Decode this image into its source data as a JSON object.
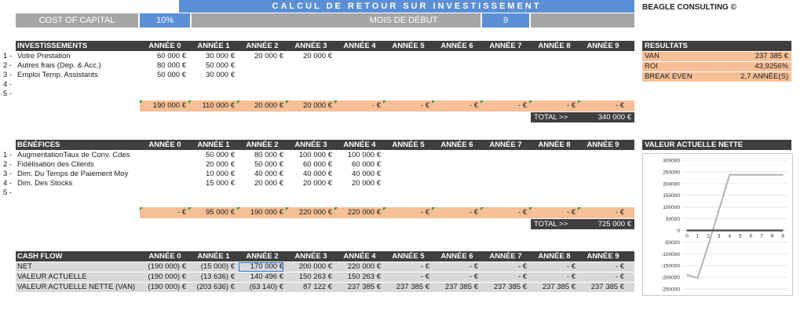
{
  "title": "CALCUL DE RETOUR SUR INVESTISSEMENT",
  "brand": "BEAGLE CONSULTING ©",
  "cost_of_capital": {
    "label": "COST OF CAPITAL",
    "value": "10%"
  },
  "start_month": {
    "label": "MOIS DE DÉBUT",
    "value": "9"
  },
  "years": [
    "ANNÉE 0",
    "ANNÉE 1",
    "ANNÉE 2",
    "ANNÉE 3",
    "ANNÉE 4",
    "ANNÉE 5",
    "ANNÉE 6",
    "ANNÉE 7",
    "ANNÉE 8",
    "ANNÉE 9"
  ],
  "investments": {
    "title": "INVESTISSEMENTS",
    "rows": [
      {
        "idx": "1 -",
        "label": "Votre Prestation",
        "values": [
          "60 000  €",
          "30 000  €",
          "20 000  €",
          "20 000  €",
          "",
          "",
          "",
          "",
          "",
          ""
        ]
      },
      {
        "idx": "2 -",
        "label": "Autres frais (Dep. & Acc.)",
        "values": [
          "80 000  €",
          "50 000  €",
          "",
          "",
          "",
          "",
          "",
          "",
          "",
          ""
        ]
      },
      {
        "idx": "3 -",
        "label": "Emploi Temp. Assistants",
        "values": [
          "50 000  €",
          "30 000  €",
          "",
          "",
          "",
          "",
          "",
          "",
          "",
          ""
        ]
      },
      {
        "idx": "4 -",
        "label": "",
        "values": [
          "",
          "",
          "",
          "",
          "",
          "",
          "",
          "",
          "",
          ""
        ]
      },
      {
        "idx": "5 -",
        "label": "",
        "values": [
          "",
          "",
          "",
          "",
          "",
          "",
          "",
          "",
          "",
          ""
        ]
      }
    ],
    "totals": [
      "190 000  €",
      "110 000  €",
      "20 000  €",
      "20 000  €",
      "-  €",
      "-  €",
      "-  €",
      "-  €",
      "-  €",
      "-  €"
    ],
    "total_label": "TOTAL >>",
    "total_value": "340 000  €"
  },
  "results": {
    "title": "RESULTATS",
    "rows": [
      {
        "label": "VAN",
        "value": "237 385  €"
      },
      {
        "label": "ROI",
        "value": "43,9256%"
      },
      {
        "label": "BREAK EVEN",
        "value": "2,7  ANNÉE(S)"
      }
    ]
  },
  "benefits": {
    "title": "BÉNÉFICES",
    "rows": [
      {
        "idx": "1 -",
        "label": "AugmentationTaux de Conv. Cdes",
        "values": [
          "",
          "50 000  €",
          "80 000  €",
          "100 000  €",
          "100 000  €",
          "",
          "",
          "",
          "",
          ""
        ]
      },
      {
        "idx": "2 -",
        "label": "Fidélisation des Clients",
        "values": [
          "",
          "20 000  €",
          "50 000  €",
          "60 000  €",
          "60 000  €",
          "",
          "",
          "",
          "",
          ""
        ]
      },
      {
        "idx": "3 -",
        "label": "Dim. Du Temps de Paiement Moy",
        "values": [
          "",
          "10 000  €",
          "40 000  €",
          "40 000  €",
          "40 000  €",
          "",
          "",
          "",
          "",
          ""
        ]
      },
      {
        "idx": "4 -",
        "label": "Dim. Des Stocks",
        "values": [
          "",
          "15 000  €",
          "20 000  €",
          "20 000  €",
          "20 000  €",
          "",
          "",
          "",
          "",
          ""
        ]
      },
      {
        "idx": "5 -",
        "label": "",
        "values": [
          "",
          "",
          "",
          "",
          "",
          "",
          "",
          "",
          "",
          ""
        ]
      }
    ],
    "totals": [
      "-  €",
      "95 000  €",
      "190 000  €",
      "220 000  €",
      "220 000  €",
      "-  €",
      "-  €",
      "-  €",
      "-  €",
      "-  €"
    ],
    "total_label": "TOTAL >>",
    "total_value": "725 000  €"
  },
  "cashflow": {
    "title": "CASH FLOW",
    "rows": [
      {
        "label": "NET",
        "values": [
          "(190 000) €",
          "(15 000) €",
          "170 000  €",
          "200 000  €",
          "220 000  €",
          "-  €",
          "-  €",
          "-  €",
          "-  €",
          "-  €"
        ]
      },
      {
        "label": "VALEUR ACTUELLE",
        "values": [
          "(190 000) €",
          "(13 636) €",
          "140 496  €",
          "150 263  €",
          "150 263  €",
          "-  €",
          "-  €",
          "-  €",
          "-  €",
          "-  €"
        ]
      },
      {
        "label": "VALEUR ACTUELLE NETTE (VAN)",
        "values": [
          "(190 000) €",
          "(203 636) €",
          "(63 140) €",
          "87 122  €",
          "237 385  €",
          "237 385  €",
          "237 385  €",
          "237 385  €",
          "237 385  €",
          "237 385  €"
        ]
      }
    ]
  },
  "chart_data": {
    "type": "line",
    "title": "VALEUR ACTUELLE NETTE",
    "x": [
      0,
      1,
      2,
      3,
      4,
      5,
      6,
      7,
      8,
      9
    ],
    "series": [
      {
        "values": [
          -190000,
          -203636,
          -63140,
          87122,
          237385,
          237385,
          237385,
          237385,
          237385,
          237385
        ],
        "color": "#b3b3b3"
      },
      {
        "values": [
          0,
          0,
          0,
          0,
          0,
          0,
          0,
          0,
          0,
          0
        ],
        "color": "#555555"
      }
    ],
    "y_ticks": [
      "300000",
      "250000",
      "200000",
      "150000",
      "100000",
      "50000",
      "0",
      "-50000",
      "-100000",
      "-150000",
      "-200000",
      "-250000"
    ],
    "ylim": [
      -250000,
      300000
    ],
    "grid": true
  }
}
